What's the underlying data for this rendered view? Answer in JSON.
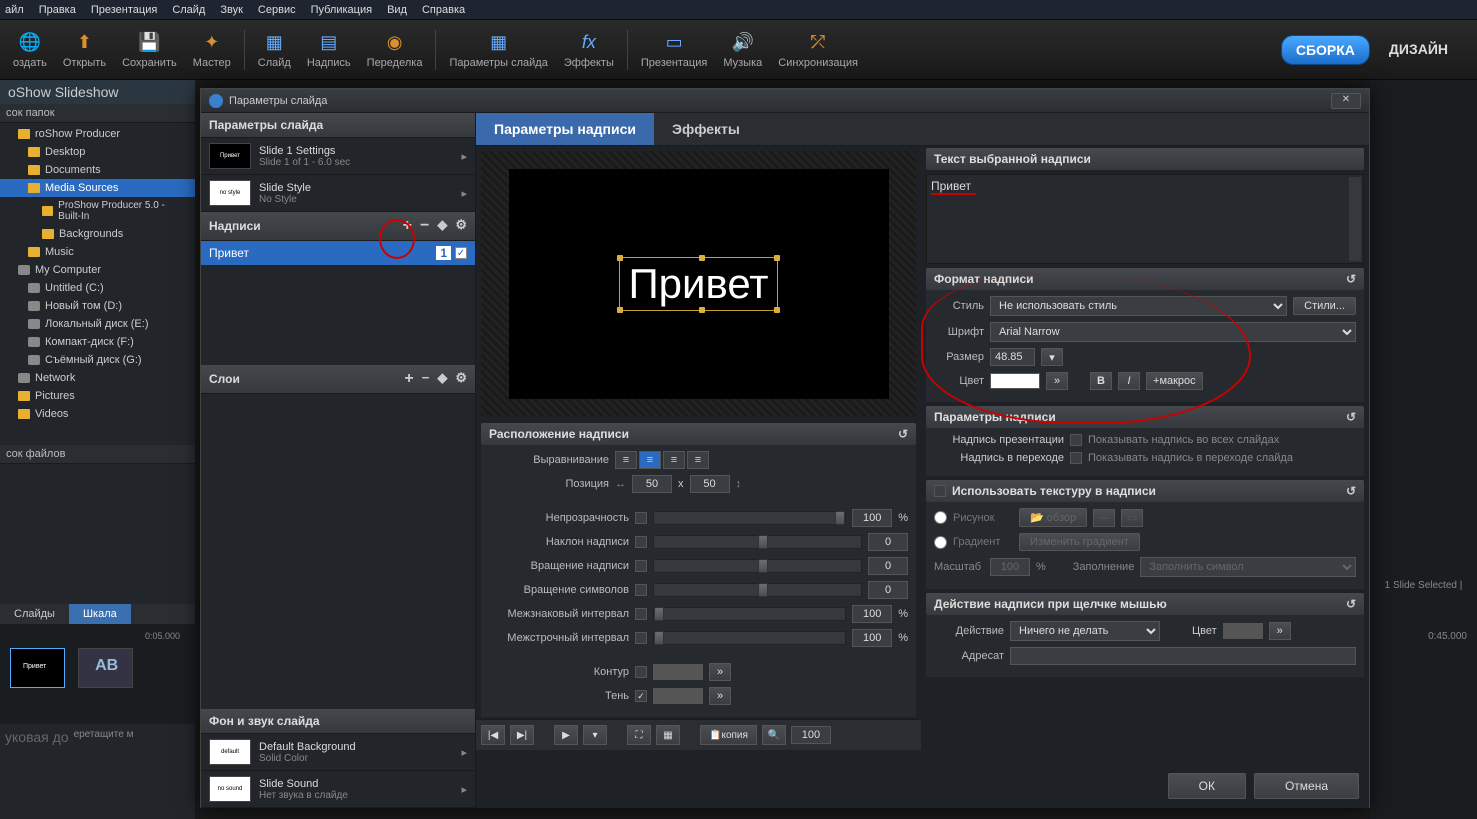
{
  "menubar": [
    "айл",
    "Правка",
    "Презентация",
    "Слайд",
    "Звук",
    "Сервис",
    "Публикация",
    "Вид",
    "Справка"
  ],
  "toolbar": [
    {
      "label": "оздать",
      "icon": "🔵"
    },
    {
      "label": "Открыть",
      "icon": "📂"
    },
    {
      "label": "Сохранить",
      "icon": "💾"
    },
    {
      "label": "Мастер",
      "icon": "✨"
    },
    {
      "sep": true
    },
    {
      "label": "Слайд",
      "icon": "➕"
    },
    {
      "label": "Надпись",
      "icon": "📝"
    },
    {
      "label": "Переделка",
      "icon": "🔄"
    },
    {
      "sep": true
    },
    {
      "label": "Параметры слайда",
      "icon": "🎞"
    },
    {
      "label": "Эффекты",
      "icon": "fx"
    },
    {
      "sep": true
    },
    {
      "label": "Презентация",
      "icon": "🖵"
    },
    {
      "label": "Музыка",
      "icon": "🔊"
    },
    {
      "label": "Синхронизация",
      "icon": "🔀"
    }
  ],
  "modes": {
    "build": "СБОРКА",
    "design": "ДИЗАЙН"
  },
  "app_title": "oShow Slideshow",
  "folders_header": "сок папок",
  "files_header": "сок файлов",
  "tree": [
    {
      "label": "roShow Producer",
      "cls": ""
    },
    {
      "label": "Desktop",
      "cls": "ind1"
    },
    {
      "label": "Documents",
      "cls": "ind1"
    },
    {
      "label": "Media Sources",
      "cls": "ind1",
      "sel": true
    },
    {
      "label": "ProShow Producer 5.0 - Built-In",
      "cls": "ind2"
    },
    {
      "label": "Backgrounds",
      "cls": "ind2"
    },
    {
      "label": "Music",
      "cls": "ind1"
    },
    {
      "label": "My Computer",
      "cls": ""
    },
    {
      "label": "Untitled (C:)",
      "cls": "ind1"
    },
    {
      "label": "Новый том (D:)",
      "cls": "ind1"
    },
    {
      "label": "Локальный диск (E:)",
      "cls": "ind1"
    },
    {
      "label": "Компакт-диск (F:)",
      "cls": "ind1"
    },
    {
      "label": "Съёмный диск (G:)",
      "cls": "ind1"
    },
    {
      "label": "Network",
      "cls": ""
    },
    {
      "label": "Pictures",
      "cls": ""
    },
    {
      "label": "Videos",
      "cls": ""
    }
  ],
  "bottom_tabs": {
    "slides": "Слайды",
    "scale": "Шкала"
  },
  "timeline": {
    "time1": "0:05.000",
    "time2": "0:45.000",
    "thumb_text": "Привет"
  },
  "drag_hint": "уковая до",
  "drag_hint2": "еретащите м",
  "right_info": "1 Slide Selected  |",
  "dialog": {
    "title": "Параметры слайда",
    "left": {
      "params_head": "Параметры слайда",
      "slide1": {
        "t1": "Slide 1 Settings",
        "t2": "Slide 1 of 1 - 6.0 sec",
        "thumb": "Привет"
      },
      "style": {
        "t1": "Slide Style",
        "t2": "No Style",
        "thumb": "no style"
      },
      "captions_head": "Надписи",
      "caption_item": "Привет",
      "caption_num": "1",
      "layers_head": "Слои",
      "bg_head": "Фон и звук слайда",
      "bg1": {
        "t1": "Default Background",
        "t2": "Solid Color",
        "thumb": "default"
      },
      "bg2": {
        "t1": "Slide Sound",
        "t2": "Нет звука в слайде",
        "thumb": "no sound"
      }
    },
    "tabs": {
      "caption_params": "Параметры надписи",
      "effects": "Эффекты"
    },
    "preview_text": "Привет",
    "text_section": {
      "head": "Текст выбранной надписи",
      "value": "Привет"
    },
    "format": {
      "head": "Формат надписи",
      "style_label": "Стиль",
      "style_value": "Не использовать стиль",
      "styles_btn": "Стили...",
      "font_label": "Шрифт",
      "font_value": "Arial Narrow",
      "size_label": "Размер",
      "size_value": "48.85",
      "color_label": "Цвет",
      "macros_btn": "макрос",
      "bold": "B",
      "italic": "I"
    },
    "position": {
      "head": "Расположение надписи",
      "align_label": "Выравнивание",
      "pos_label": "Позиция",
      "pos_x": "50",
      "pos_x_pre": "x",
      "pos_y": "50",
      "opacity_label": "Непрозрачность",
      "opacity_val": "100",
      "skew_label": "Наклон надписи",
      "skew_val": "0",
      "rot_label": "Вращение надписи",
      "rot_val": "0",
      "char_rot_label": "Вращение символов",
      "char_rot_val": "0",
      "char_spacing_label": "Межзнаковый интервал",
      "char_spacing_val": "100",
      "line_spacing_label": "Межстрочный интервал",
      "line_spacing_val": "100",
      "outline_label": "Контур",
      "shadow_label": "Тень",
      "pct": "%"
    },
    "caption_params": {
      "head": "Параметры надписи",
      "global_label": "Надпись презентации",
      "global_hint": "Показывать надпись во всех слайдах",
      "trans_label": "Надпись в переходе",
      "trans_hint": "Показывать надпись в переходе слайда"
    },
    "texture": {
      "head": "Использовать текстуру в надписи",
      "image_label": "Рисунок",
      "browse_btn": "обзор",
      "gradient_label": "Градиент",
      "gradient_btn": "Изменить градиент",
      "scale_label": "Масштаб",
      "scale_val": "100",
      "fill_label": "Заполнение",
      "fill_hint": "Заполнить символ"
    },
    "action": {
      "head": "Действие надписи при щелчке мышью",
      "action_label": "Действие",
      "action_value": "Ничего не делать",
      "color_label": "Цвет",
      "dest_label": "Адресат"
    },
    "playback": {
      "copy": "копия",
      "zoom": "100"
    },
    "footer": {
      "ok": "ОК",
      "cancel": "Отмена"
    }
  }
}
